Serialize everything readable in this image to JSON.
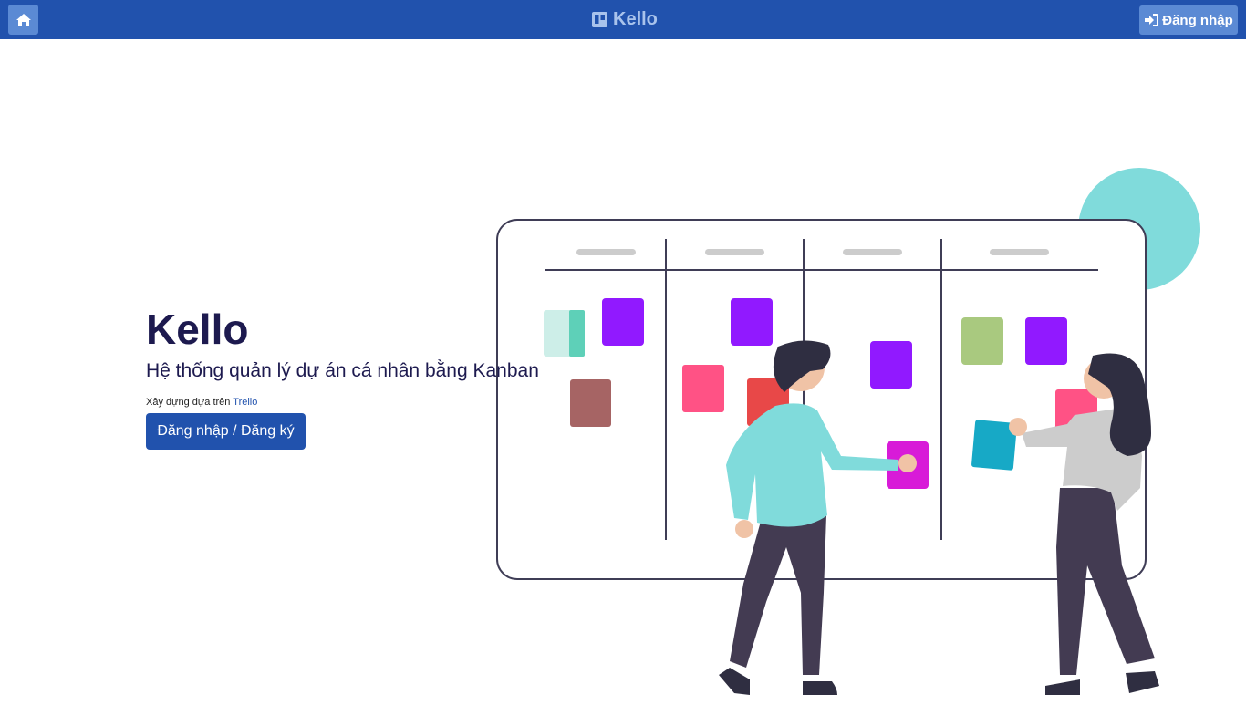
{
  "navbar": {
    "home_icon": "home-icon",
    "brand_icon": "trello-board-icon",
    "brand_name": "Kello",
    "login_icon": "sign-in-icon",
    "login_label": "Đăng nhập"
  },
  "hero": {
    "title": "Kello",
    "subtitle": "Hệ thống quản lý dự án cá nhân bằng Kanban",
    "built_prefix": "Xây dựng dựa trên",
    "built_link": "Trello",
    "cta_label": "Đăng nhập / Đăng ký"
  },
  "illustration": {
    "subject": "two-people-at-kanban-board"
  },
  "colors": {
    "navbar_bg": "#2152ad",
    "nav_button_bg": "#5b8ad4",
    "title_color": "#1d1a4f",
    "accent_teal": "#80dbdb",
    "sticky_purple": "#9119ff",
    "sticky_pink": "#ff5285",
    "sticky_red": "#e84848",
    "sticky_brown": "#a66464",
    "sticky_green": "#a9c97f",
    "sticky_magenta": "#d81bd8",
    "sticky_cyan": "#17a9c6",
    "dark_figure": "#433b52"
  }
}
